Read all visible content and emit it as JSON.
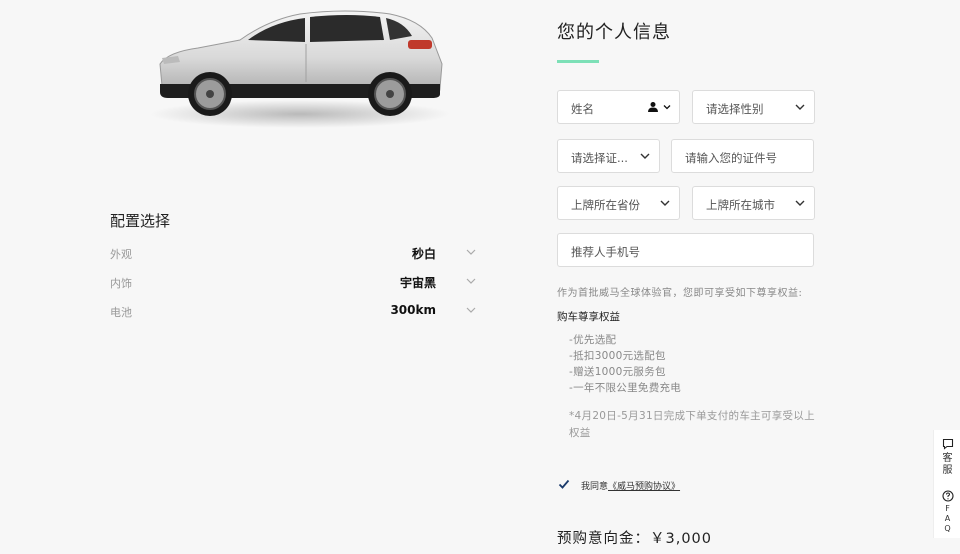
{
  "config": {
    "title": "配置选择",
    "rows": [
      {
        "key": "外观",
        "value": "秒白"
      },
      {
        "key": "内饰",
        "value": "宇宙黑"
      },
      {
        "key": "电池",
        "value": "300km"
      }
    ]
  },
  "form": {
    "title": "您的个人信息",
    "name_placeholder": "姓名",
    "gender_placeholder": "请选择性别",
    "id_type_placeholder": "请选择证...",
    "id_number_placeholder": "请输入您的证件号",
    "province_placeholder": "上牌所在省份",
    "city_placeholder": "上牌所在城市",
    "referrer_placeholder": "推荐人手机号"
  },
  "benefits": {
    "intro": "作为首批威马全球体验官，您即可享受如下尊享权益:",
    "title": "购车尊享权益",
    "items": [
      "-优先选配",
      "-抵扣3000元选配包",
      "-赠送1000元服务包",
      "-一年不限公里免费充电"
    ],
    "note": "*4月20日-5月31日完成下单支付的车主可享受以上权益"
  },
  "agreement": {
    "prefix": "我同意",
    "link": "《威马预购协议》",
    "checked": true
  },
  "deposit": "预购意向金：￥3,000",
  "sidebar": {
    "service_label": "客服",
    "faq_label": "FAQ"
  },
  "colors": {
    "accent": "#7de0b7",
    "checkmark": "#1a3a6b"
  },
  "icons": [
    "person-icon",
    "chevron-down-icon",
    "check-icon",
    "chat-icon",
    "help-icon"
  ]
}
